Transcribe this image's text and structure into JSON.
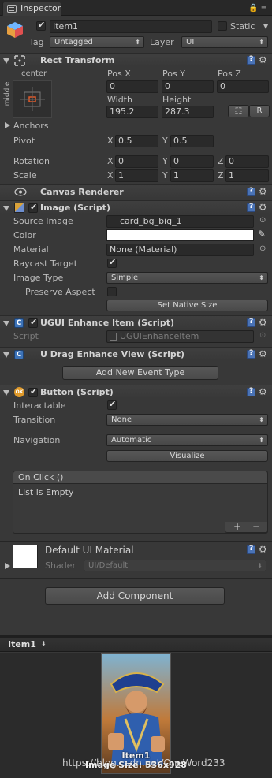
{
  "tab": {
    "title": "Inspector"
  },
  "object": {
    "name": "Item1",
    "static_label": "Static",
    "tag_label": "Tag",
    "tag_value": "Untagged",
    "layer_label": "Layer",
    "layer_value": "UI"
  },
  "rect_transform": {
    "title": "Rect Transform",
    "anchor_h": "center",
    "anchor_v": "middle",
    "pos_x_label": "Pos X",
    "pos_y_label": "Pos Y",
    "pos_z_label": "Pos Z",
    "pos_x": "0",
    "pos_y": "0",
    "pos_z": "0",
    "width_label": "Width",
    "height_label": "Height",
    "width": "195.2",
    "height": "287.3",
    "r_button": "R",
    "anchors_label": "Anchors",
    "pivot_label": "Pivot",
    "pivot_x": "0.5",
    "pivot_y": "0.5",
    "rotation_label": "Rotation",
    "rot_x": "0",
    "rot_y": "0",
    "rot_z": "0",
    "scale_label": "Scale",
    "scale_x": "1",
    "scale_y": "1",
    "scale_z": "1",
    "x": "X",
    "y": "Y",
    "z": "Z"
  },
  "canvas_renderer": {
    "title": "Canvas Renderer"
  },
  "image": {
    "title": "Image (Script)",
    "source_label": "Source Image",
    "source_value": "card_bg_big_1",
    "color_label": "Color",
    "material_label": "Material",
    "material_value": "None (Material)",
    "raycast_label": "Raycast Target",
    "image_type_label": "Image Type",
    "image_type_value": "Simple",
    "preserve_label": "Preserve Aspect",
    "native_size_button": "Set Native Size"
  },
  "ugui_enhance": {
    "title": "UGUI Enhance Item (Script)",
    "script_label": "Script",
    "script_value": "UGUIEnhanceItem"
  },
  "drag_view": {
    "title": "U Drag Enhance View (Script)",
    "add_event_button": "Add New Event Type"
  },
  "button": {
    "title": "Button (Script)",
    "interactable_label": "Interactable",
    "transition_label": "Transition",
    "transition_value": "None",
    "navigation_label": "Navigation",
    "navigation_value": "Automatic",
    "visualize_button": "Visualize",
    "onclick_title": "On Click ()",
    "list_empty": "List is Empty",
    "plus": "+",
    "minus": "−"
  },
  "material": {
    "title": "Default UI Material",
    "shader_label": "Shader",
    "shader_value": "UI/Default"
  },
  "add_component_button": "Add Component",
  "preview": {
    "title": "Item1",
    "image_name": "Item1",
    "image_size": "Image Size: 536x928",
    "watermark": "https://blog.csdn.net/OneWord233"
  },
  "colors": {
    "panel": "#383838",
    "field": "#2a2a2a",
    "accent_blue": "#3d73b8"
  }
}
